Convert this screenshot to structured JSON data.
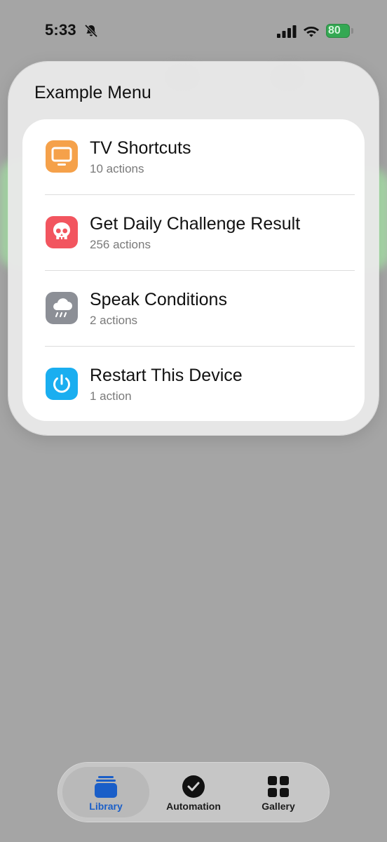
{
  "status_bar": {
    "time": "5:33",
    "battery_level": "80",
    "icons": [
      "bell-slash-icon",
      "signal-icon",
      "wifi-icon",
      "battery-icon"
    ]
  },
  "menu": {
    "title": "Example Menu",
    "items": [
      {
        "title": "TV Shortcuts",
        "subtitle": "10 actions",
        "icon": "tv-icon",
        "color": "#f5a14a"
      },
      {
        "title": "Get Daily Challenge Result",
        "subtitle": "256 actions",
        "icon": "skull-icon",
        "color": "#f2555f"
      },
      {
        "title": "Speak Conditions",
        "subtitle": "2 actions",
        "icon": "cloud-rain-icon",
        "color": "#8c8f96"
      },
      {
        "title": "Restart This Device",
        "subtitle": "1 action",
        "icon": "power-icon",
        "color": "#1aaef0"
      }
    ]
  },
  "tab_bar": {
    "tabs": [
      {
        "label": "Library",
        "icon": "library-icon",
        "active": true
      },
      {
        "label": "Automation",
        "icon": "clock-icon",
        "active": false
      },
      {
        "label": "Gallery",
        "icon": "grid-icon",
        "active": false
      }
    ],
    "accent_color": "#1a5ec8"
  }
}
